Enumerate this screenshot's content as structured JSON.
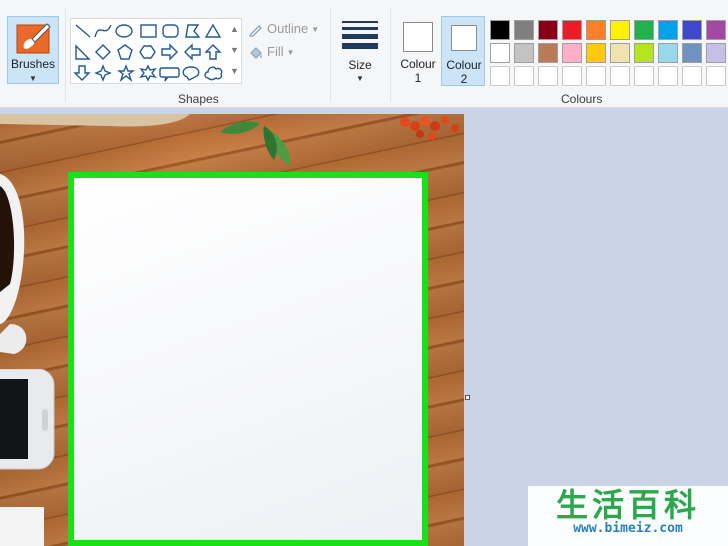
{
  "ribbon": {
    "brushes": {
      "label": "Brushes"
    },
    "shapes": {
      "group_label": "Shapes",
      "outline_label": "Outline",
      "fill_label": "Fill"
    },
    "size": {
      "label": "Size"
    },
    "colours": {
      "group_label": "Colours",
      "colour1": {
        "line1": "Colour",
        "line2": "1",
        "value": "#ffffff"
      },
      "colour2": {
        "line1": "Colour",
        "line2": "2",
        "value": "#ffffff"
      },
      "palette_row1": [
        "#000000",
        "#7f7f7f",
        "#880015",
        "#ed1c24",
        "#ff7f27",
        "#fff200",
        "#22b14c",
        "#00a2e8",
        "#3f48cc",
        "#a349a4"
      ],
      "palette_row2": [
        "#ffffff",
        "#c3c3c3",
        "#b97a57",
        "#ffaec9",
        "#ffc90e",
        "#efe4b0",
        "#b5e61d",
        "#99d9ea",
        "#7092be",
        "#c8bfe7"
      ]
    }
  },
  "canvas": {
    "frame_color": "#19e019"
  },
  "watermark": {
    "title": "生活百科",
    "url": "www.bimeiz.com"
  }
}
